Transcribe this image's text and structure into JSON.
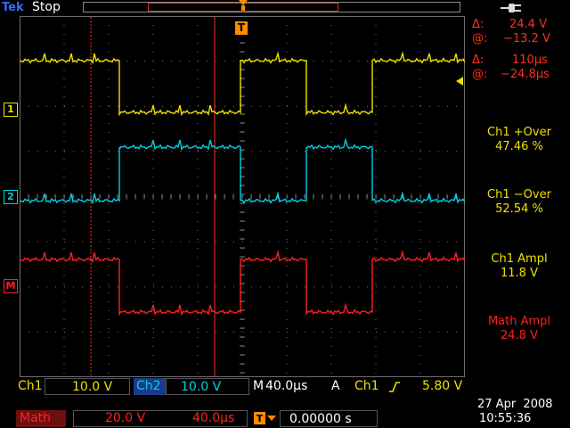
{
  "status": {
    "brand": "Tek",
    "run_state": "Stop"
  },
  "cursors": {
    "delta_v_symbol": "Δ:",
    "delta_v": "24.4 V",
    "at_v_symbol": "@:",
    "at_v": "−13.2 V",
    "delta_t_symbol": "Δ:",
    "delta_t": "110µs",
    "at_t_symbol": "@:",
    "at_t": "−24.8µs"
  },
  "measurements": [
    {
      "title": "Ch1 +Over",
      "value": "47.46 %"
    },
    {
      "title": "Ch1 −Over",
      "value": "52.54 %"
    },
    {
      "title": "Ch1 Ampl",
      "value": "11.8 V"
    },
    {
      "title": "Math Ampl",
      "value": "24.8 V"
    }
  ],
  "channel_markers": {
    "ch1": "1",
    "ch2": "2",
    "math": "M"
  },
  "scales": {
    "ch1_label": "Ch1",
    "ch1_value": "10.0 V",
    "ch2_label": "Ch2",
    "ch2_value": "10.0 V",
    "horiz_label": "M",
    "horiz_value": "40.0µs",
    "trig_mode": "A",
    "trig_source": "Ch1",
    "trig_level": "5.80 V"
  },
  "math_bar": {
    "label": "Math",
    "vscale": "20.0 V",
    "hscale": "40.0µs",
    "trig_position": "0.00000 s"
  },
  "datetime": {
    "date": "27 Apr  2008",
    "time": "10:55:36"
  },
  "colors": {
    "ch1": "#f0e000",
    "ch2": "#00d0e0",
    "math": "#ff2020",
    "cursor": "#ff3020",
    "measure": "#f0e000",
    "math_text": "#ff2020"
  }
}
